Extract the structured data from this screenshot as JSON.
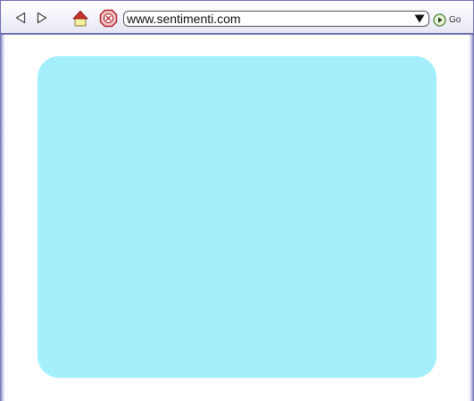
{
  "browser": {
    "url": "www.sentimenti.com",
    "go_label": "Go"
  },
  "icons": {
    "back": "back-arrow-icon",
    "forward": "forward-arrow-icon",
    "home": "home-icon",
    "stop": "stop-icon",
    "dropdown": "dropdown-arrow-icon",
    "go": "go-play-icon"
  },
  "colors": {
    "chrome_border": "#6d6dac",
    "content_panel": "#a3f0fc",
    "home_roof": "#c8322d",
    "home_body": "#f7eea0",
    "stop_fill": "#f2c6c6",
    "stop_border": "#b0202a",
    "go_fill": "#e8f4d8",
    "go_border": "#4d7a2a"
  }
}
